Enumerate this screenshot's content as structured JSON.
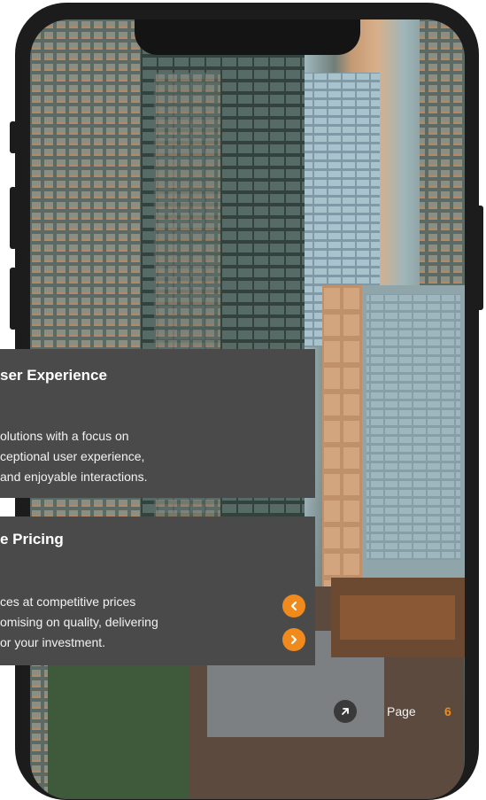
{
  "cards": [
    {
      "title": "ser Experience",
      "lines": [
        "olutions with a focus on",
        "ceptional user experience,",
        "and enjoyable interactions."
      ]
    },
    {
      "title": "e Pricing",
      "lines": [
        "ces at competitive prices",
        "omising on quality, delivering",
        "or your investment."
      ]
    }
  ],
  "nav": {
    "prev_icon": "chevron-left-icon",
    "next_icon": "chevron-right-icon"
  },
  "pager": {
    "icon": "arrow-up-right-icon",
    "label": "Page",
    "number": "6"
  },
  "colors": {
    "accent": "#f08a1c",
    "card": "#4a4a4a",
    "frame": "#1c1c1c"
  }
}
